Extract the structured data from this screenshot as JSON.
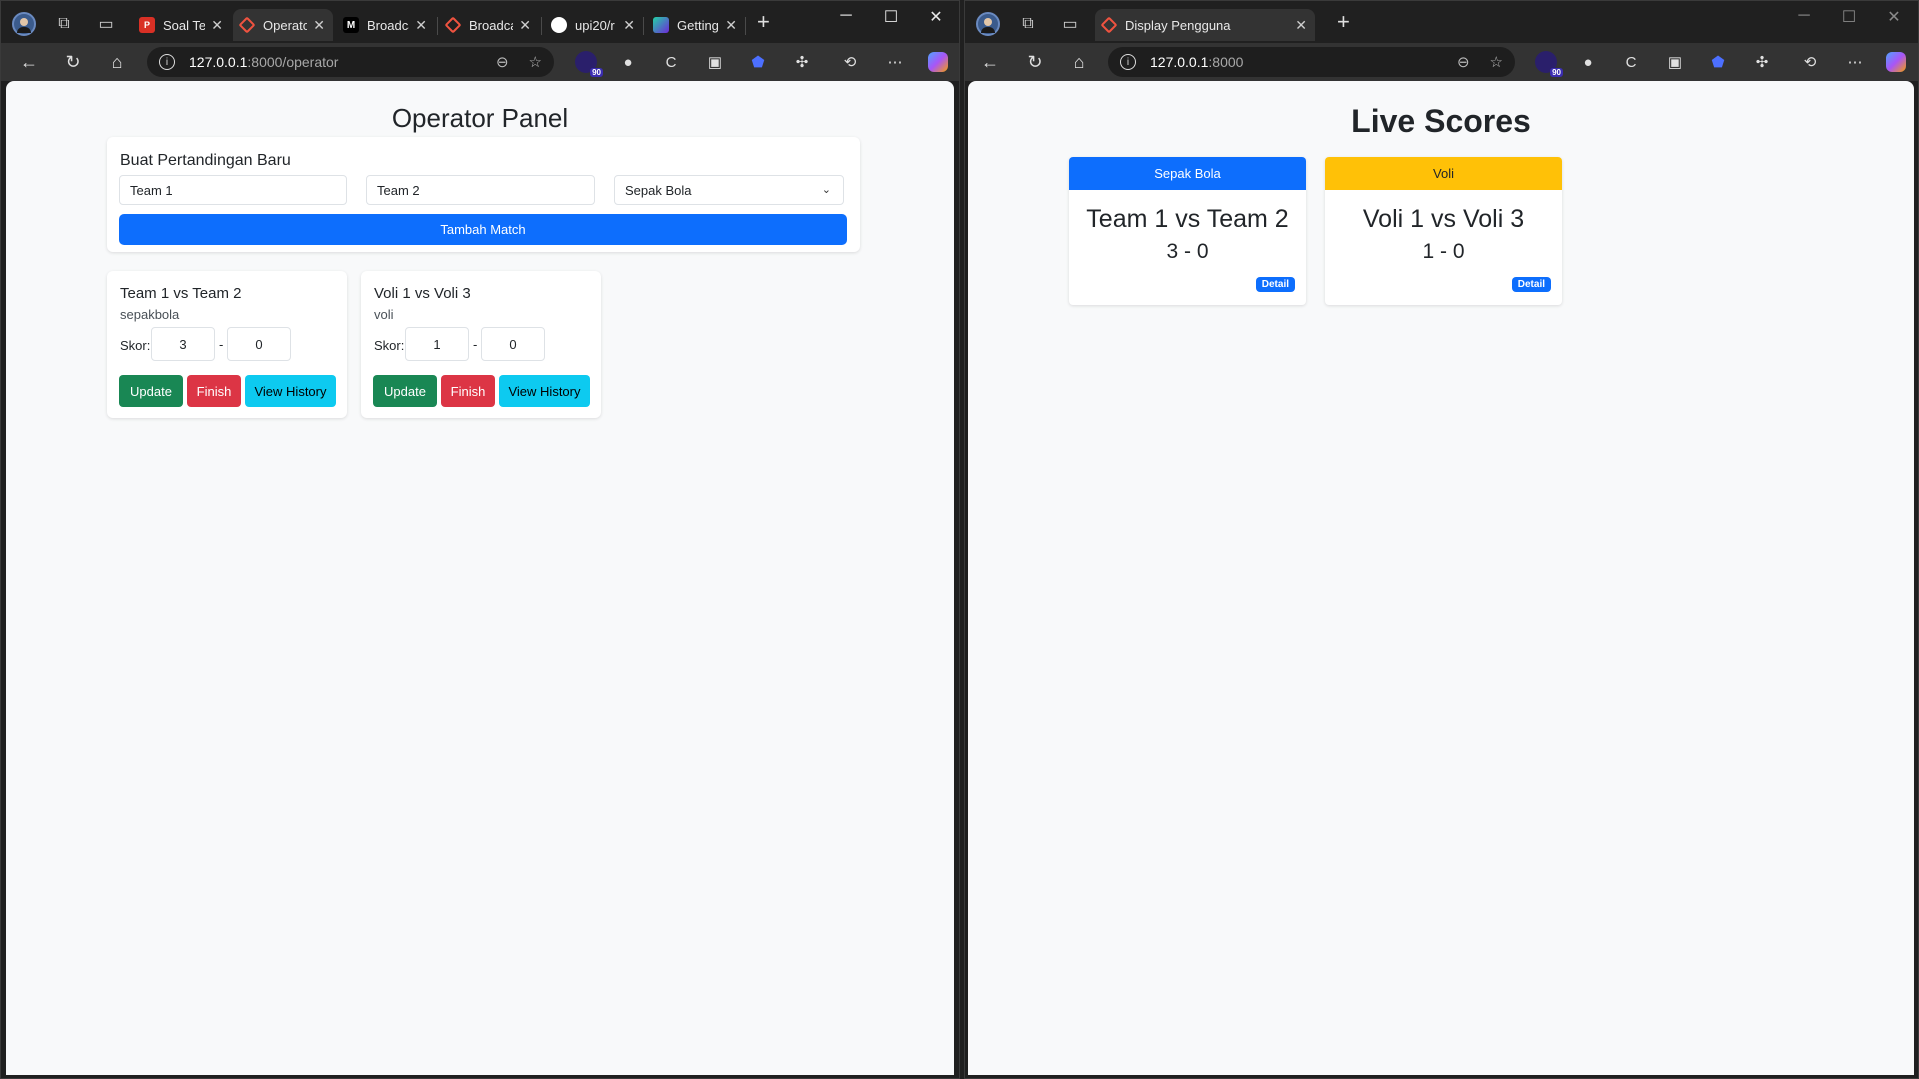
{
  "left_window": {
    "tabs": [
      {
        "title": "Soal Tes",
        "favicon": "pdf-icon"
      },
      {
        "title": "Operator",
        "favicon": "laravel-icon",
        "active": true
      },
      {
        "title": "Broadcast",
        "favicon": "medium-icon"
      },
      {
        "title": "Broadcast",
        "favicon": "laravel-icon"
      },
      {
        "title": "upi20/r",
        "favicon": "github-icon"
      },
      {
        "title": "Getting",
        "favicon": "getting-icon"
      }
    ],
    "url_host": "127.0.0.1",
    "url_path": ":8000/operator",
    "extension_badge": "90"
  },
  "right_window": {
    "tabs": [
      {
        "title": "Display Pengguna",
        "favicon": "laravel-icon",
        "active": true
      }
    ],
    "url_host": "127.0.0.1",
    "url_path": ":8000",
    "extension_badge": "90"
  },
  "operator": {
    "title": "Operator Panel",
    "create": {
      "heading": "Buat Pertandingan Baru",
      "team1_value": "Team 1",
      "team2_value": "Team 2",
      "sport_selected": "Sepak Bola",
      "submit_label": "Tambah Match"
    },
    "matches": [
      {
        "title": "Team 1 vs Team 2",
        "sport": "sepakbola",
        "skor_label": "Skor:",
        "score_a": "3",
        "score_b": "0",
        "update_label": "Update",
        "finish_label": "Finish",
        "history_label": "View History"
      },
      {
        "title": "Voli 1 vs Voli 3",
        "sport": "voli",
        "skor_label": "Skor:",
        "score_a": "1",
        "score_b": "0",
        "update_label": "Update",
        "finish_label": "Finish",
        "history_label": "View History"
      }
    ]
  },
  "display": {
    "title": "Live Scores",
    "cards": [
      {
        "sport": "Sepak Bola",
        "teams": "Team 1 vs Team 2",
        "score": "3 - 0",
        "detail_label": "Detail",
        "header_color": "#0d6efd"
      },
      {
        "sport": "Voli",
        "teams": "Voli 1 vs Voli 3",
        "score": "1 - 0",
        "detail_label": "Detail",
        "header_color": "#ffc107"
      }
    ]
  },
  "colors": {
    "primary": "#0d6efd",
    "success": "#198754",
    "danger": "#dc3545",
    "info": "#0dcaf0",
    "warning": "#ffc107"
  }
}
